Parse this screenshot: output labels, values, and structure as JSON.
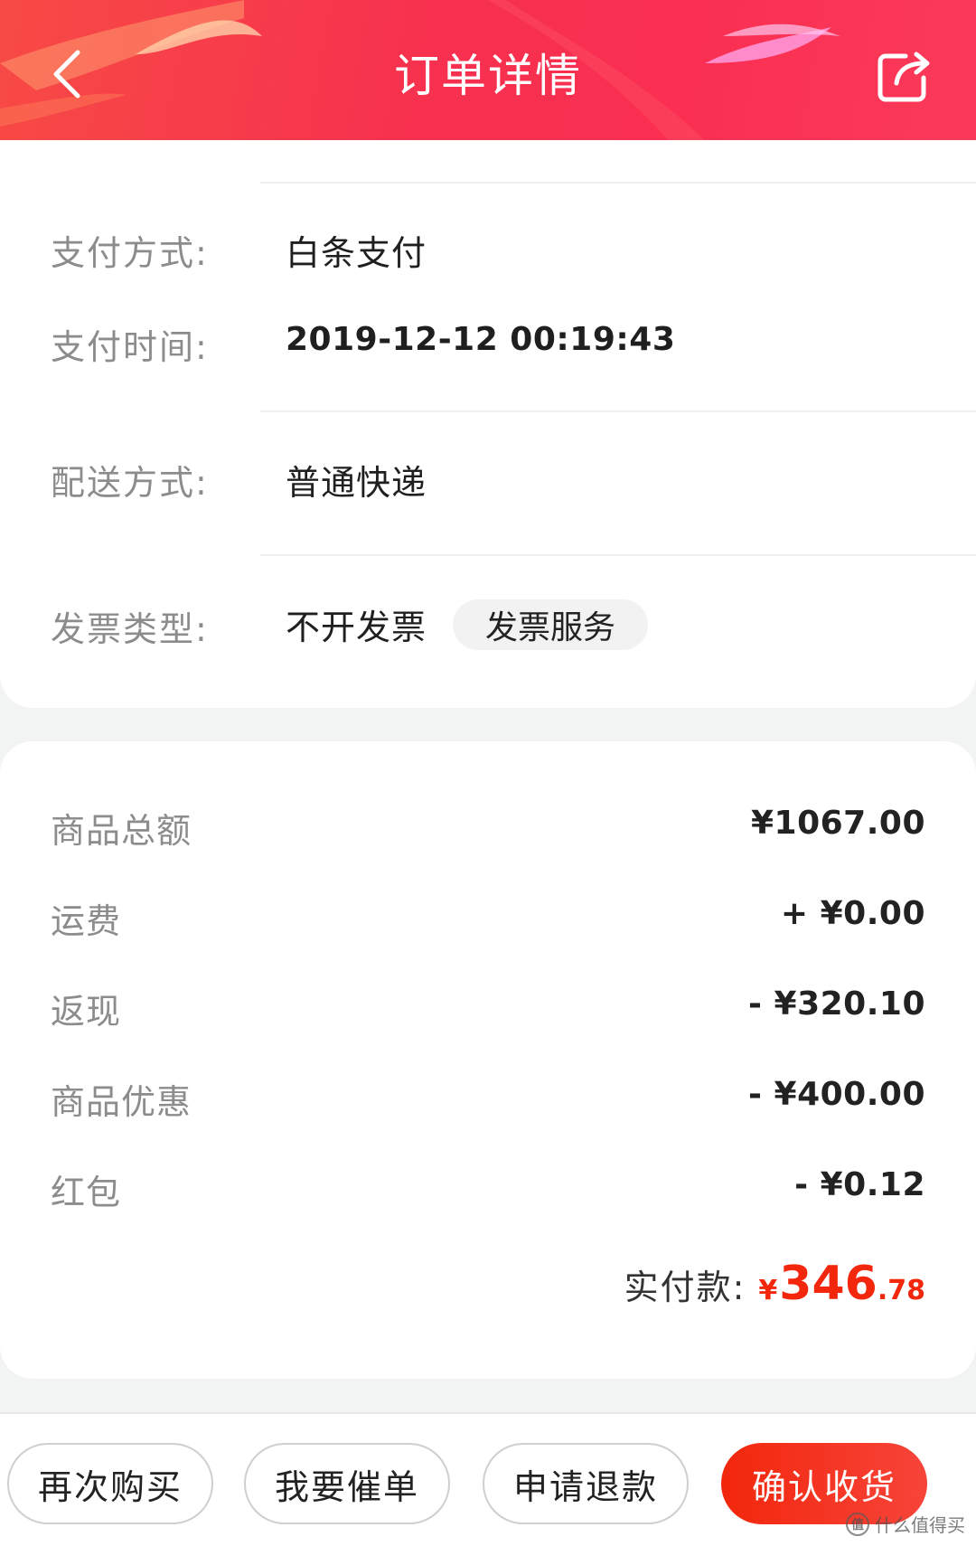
{
  "header": {
    "title": "订单详情",
    "back_icon": "chevron-left-icon",
    "share_icon": "share-icon"
  },
  "order_info": {
    "payment_method_label": "支付方式:",
    "payment_method_value": "白条支付",
    "payment_time_label": "支付时间:",
    "payment_time_value": "2019-12-12 00:19:43",
    "delivery_label": "配送方式:",
    "delivery_value": "普通快递",
    "invoice_label": "发票类型:",
    "invoice_value": "不开发票",
    "invoice_service_button": "发票服务"
  },
  "fees": {
    "items": [
      {
        "label": "商品总额",
        "value": "¥1067.00"
      },
      {
        "label": "运费",
        "value": "+ ¥0.00"
      },
      {
        "label": "返现",
        "value": "- ¥320.10"
      },
      {
        "label": "商品优惠",
        "value": "- ¥400.00"
      },
      {
        "label": "红包",
        "value": "- ¥0.12"
      }
    ],
    "total_label": "实付款:",
    "total_currency": "¥",
    "total_integer": "346",
    "total_decimal": ".78"
  },
  "actions": {
    "buy_again": "再次购买",
    "urge_order": "我要催单",
    "apply_refund": "申请退款",
    "confirm_receipt": "确认收货"
  },
  "watermark": {
    "icon_text": "值",
    "text": "什么值得买"
  },
  "colors": {
    "brand_red": "#f2270c",
    "header_gradient": "#f7304f"
  }
}
